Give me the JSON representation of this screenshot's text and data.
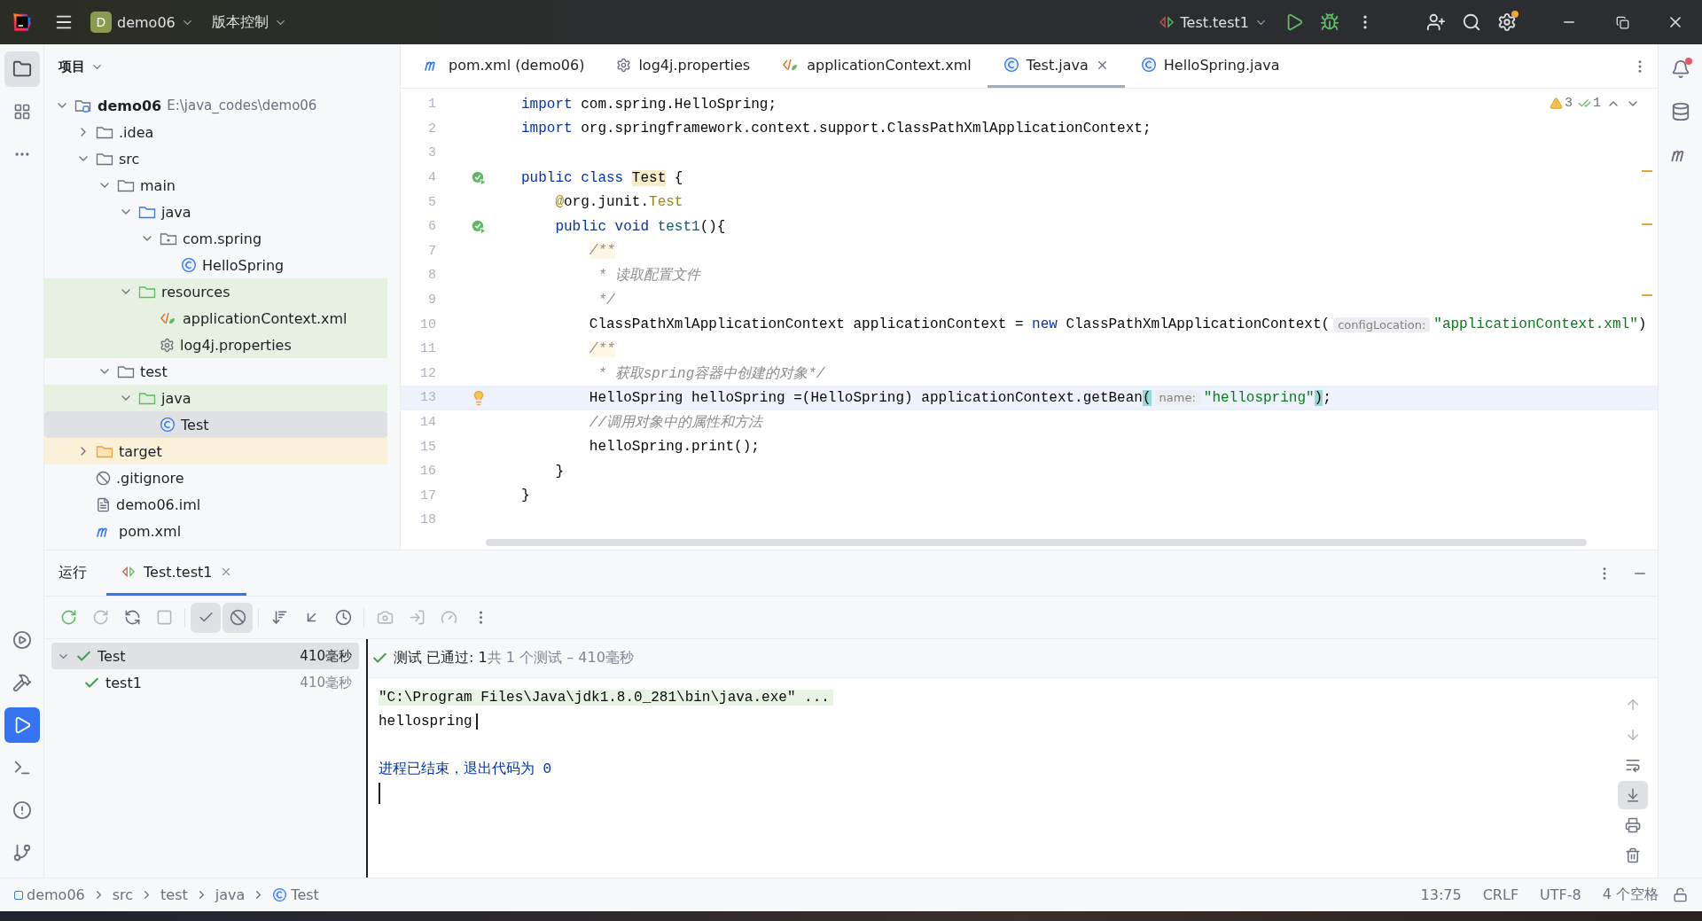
{
  "title_bar": {
    "project": {
      "initial": "D",
      "name": "demo06"
    },
    "vcs": "版本控制",
    "run_config": "Test.test1"
  },
  "project_panel": {
    "title": "项目",
    "tree": [
      {
        "label": "demo06",
        "note": "E:\\java_codes\\demo06",
        "kind": "module",
        "expanded": true,
        "selected": false,
        "children": [
          {
            "label": ".idea",
            "kind": "folder",
            "expanded": false,
            "selected": false
          },
          {
            "label": "src",
            "kind": "folder",
            "expanded": true,
            "selected": false,
            "children": [
              {
                "label": "main",
                "kind": "folder",
                "expanded": true,
                "selected": false,
                "children": [
                  {
                    "label": "java",
                    "kind": "source",
                    "expanded": true,
                    "selected": false,
                    "children": [
                      {
                        "label": "com.spring",
                        "kind": "package",
                        "expanded": true,
                        "selected": false,
                        "children": [
                          {
                            "label": "HelloSpring",
                            "kind": "class",
                            "selected": false
                          }
                        ]
                      }
                    ]
                  },
                  {
                    "label": "resources",
                    "kind": "resources",
                    "color": "#e6f2e1",
                    "expanded": true,
                    "selected": false,
                    "children": [
                      {
                        "label": "applicationContext.xml",
                        "kind": "xml",
                        "color": "#e6f2e1",
                        "selected": false
                      },
                      {
                        "label": "log4j.properties",
                        "kind": "properties",
                        "color": "#e6f2e1",
                        "selected": false
                      }
                    ]
                  }
                ]
              },
              {
                "label": "test",
                "kind": "folder",
                "expanded": true,
                "selected": false,
                "children": [
                  {
                    "label": "java",
                    "kind": "tests",
                    "color": "#e6f2e1",
                    "expanded": true,
                    "selected": false,
                    "children": [
                      {
                        "label": "Test",
                        "kind": "class",
                        "selected": true
                      }
                    ]
                  }
                ]
              }
            ]
          },
          {
            "label": "target",
            "kind": "excluded",
            "color": "#fbf1d8",
            "expanded": false,
            "selected": false
          },
          {
            "label": ".gitignore",
            "kind": "ignore",
            "selected": false
          },
          {
            "label": "demo06.iml",
            "kind": "file",
            "selected": false
          },
          {
            "label": "pom.xml",
            "kind": "maven",
            "selected": false
          }
        ]
      }
    ]
  },
  "editor_tabs": [
    {
      "label": "pom.xml (demo06)",
      "kind": "maven",
      "selected": false
    },
    {
      "label": "log4j.properties",
      "kind": "properties",
      "selected": false
    },
    {
      "label": "applicationContext.xml",
      "kind": "xml",
      "selected": false
    },
    {
      "label": "Test.java",
      "kind": "class",
      "selected": true
    },
    {
      "label": "HelloSpring.java",
      "kind": "class",
      "selected": false
    }
  ],
  "inspections": {
    "warnings": "3",
    "passed": "1"
  },
  "code": [
    {
      "number": "1",
      "current": false,
      "segments": [
        {
          "kind": "keyword",
          "text": "import"
        },
        {
          "kind": "plain",
          "text": " com.spring.HelloSpring;"
        }
      ]
    },
    {
      "number": "2",
      "current": false,
      "segments": [
        {
          "kind": "keyword",
          "text": "import"
        },
        {
          "kind": "plain",
          "text": " org.springframework.context.support.ClassPathXmlApplicationContext;"
        }
      ]
    },
    {
      "number": "3",
      "current": false
    },
    {
      "number": "4",
      "current": false,
      "kind": "run",
      "segments": [
        {
          "kind": "keyword",
          "text": "public class "
        },
        {
          "kind": "reference",
          "text": "Test"
        },
        {
          "kind": "plain",
          "text": " {"
        }
      ]
    },
    {
      "number": "5",
      "current": false,
      "segments": [
        {
          "kind": "annotation",
          "text": "    @"
        },
        {
          "kind": "plain",
          "text": "org.junit."
        },
        {
          "kind": "annotation",
          "text": "Test"
        }
      ]
    },
    {
      "number": "6",
      "current": false,
      "kind": "run",
      "segments": [
        {
          "kind": "keyword",
          "text": "    public void "
        },
        {
          "kind": "method",
          "text": "test1"
        },
        {
          "kind": "plain",
          "text": "(){"
        }
      ]
    },
    {
      "number": "7",
      "current": false,
      "segments": [
        {
          "kind": "doc",
          "text": "        /**"
        }
      ]
    },
    {
      "number": "8",
      "current": false,
      "segments": [
        {
          "kind": "comment",
          "text": "         * 读取配置文件"
        }
      ]
    },
    {
      "number": "9",
      "current": false,
      "segments": [
        {
          "kind": "comment",
          "text": "         */"
        }
      ]
    },
    {
      "number": "10",
      "current": false,
      "segments": [
        {
          "kind": "plain",
          "text": "        ClassPathXmlApplicationContext applicationContext = "
        },
        {
          "kind": "keyword",
          "text": "new"
        },
        {
          "kind": "plain",
          "text": " ClassPathXmlApplicationContext("
        },
        {
          "kind": "hint",
          "text": "configLocation:"
        },
        {
          "kind": "string",
          "text": "\"applicationContext.xml\""
        },
        {
          "kind": "plain",
          "text": ")"
        }
      ]
    },
    {
      "number": "11",
      "current": false,
      "segments": [
        {
          "kind": "doc",
          "text": "        /**"
        }
      ]
    },
    {
      "number": "12",
      "current": false,
      "segments": [
        {
          "kind": "comment",
          "text": "         * 获取spring容器中创建的对象*/"
        }
      ]
    },
    {
      "number": "13",
      "current": true,
      "kind": "bulb",
      "segments": [
        {
          "kind": "plain",
          "text": "        HelloSpring helloSpring =(HelloSpring) applicationContext.getBean"
        },
        {
          "kind": "match",
          "text": "("
        },
        {
          "kind": "hint",
          "text": "name:"
        },
        {
          "kind": "string",
          "text": "\"hellospring\""
        },
        {
          "kind": "match",
          "text": ")"
        },
        {
          "kind": "plain",
          "text": ";"
        }
      ]
    },
    {
      "number": "14",
      "current": false,
      "segments": [
        {
          "kind": "comment",
          "text": "        //调用对象中的属性和方法"
        }
      ]
    },
    {
      "number": "15",
      "current": false,
      "segments": [
        {
          "kind": "plain",
          "text": "        helloSpring.print();"
        }
      ]
    },
    {
      "number": "16",
      "current": false,
      "segments": [
        {
          "kind": "plain",
          "text": "    }"
        }
      ]
    },
    {
      "number": "17",
      "current": false,
      "segments": [
        {
          "kind": "plain",
          "text": "}"
        }
      ]
    },
    {
      "number": "18",
      "current": false
    }
  ],
  "run_panel": {
    "title": "运行",
    "tabs": [
      {
        "label": "Test.test1",
        "selected": true
      }
    ],
    "toolbar": [
      {
        "kind": "rerun",
        "on": false,
        "disabled": false
      },
      {
        "kind": "rerun-failed",
        "on": false,
        "disabled": true
      },
      {
        "kind": "toggle-auto",
        "on": false,
        "disabled": false
      },
      {
        "kind": "stop",
        "on": false,
        "disabled": true
      },
      {
        "kind": "show-passed",
        "on": true,
        "disabled": false
      },
      {
        "kind": "show-ignored",
        "on": true,
        "disabled": false
      },
      {
        "kind": "sort",
        "on": false,
        "disabled": false
      },
      {
        "kind": "collapse",
        "on": false,
        "disabled": false
      },
      {
        "kind": "history",
        "on": false,
        "disabled": false
      },
      {
        "kind": "snapshot",
        "on": false,
        "disabled": true
      },
      {
        "kind": "export",
        "on": false,
        "disabled": true
      },
      {
        "kind": "profile",
        "on": false,
        "disabled": true
      },
      {
        "kind": "more",
        "on": false,
        "disabled": false
      }
    ],
    "tests": [
      {
        "label": "Test",
        "time": "410毫秒",
        "kind": "passed",
        "expanded": true,
        "selected": true,
        "children": [
          {
            "label": "test1",
            "time": "410毫秒",
            "kind": "passed",
            "selected": false
          }
        ]
      }
    ],
    "summary": {
      "status": "测试 已通过: 1",
      "detail": "共 1 个测试 – 410毫秒"
    },
    "console": [
      {
        "kind": "command",
        "text": "\"C:\\Program Files\\Java\\jdk1.8.0_281\\bin\\java.exe\" ...",
        "caret": false
      },
      {
        "kind": "output",
        "text": "hellospring",
        "caret": true
      },
      {
        "kind": "exit",
        "text": "进程已结束，退出代码为 0",
        "caret": false
      }
    ],
    "input_cursor": true,
    "console_tools": [
      {
        "kind": "up",
        "on": false,
        "disabled": true
      },
      {
        "kind": "down",
        "on": false,
        "disabled": true
      },
      {
        "kind": "wrap",
        "on": false,
        "disabled": false
      },
      {
        "kind": "scroll-end",
        "on": true,
        "disabled": false
      },
      {
        "kind": "print",
        "on": false,
        "disabled": false
      },
      {
        "kind": "clear",
        "on": false,
        "disabled": false
      }
    ]
  },
  "status_bar": {
    "breadcrumbs": [
      {
        "label": "demo06",
        "kind": "module"
      },
      {
        "label": "src",
        "kind": "folder"
      },
      {
        "label": "test",
        "kind": "folder"
      },
      {
        "label": "java",
        "kind": "folder"
      },
      {
        "label": "Test",
        "kind": "class"
      }
    ],
    "items": [
      "13:75",
      "CRLF",
      "UTF-8",
      "4 个空格"
    ]
  }
}
